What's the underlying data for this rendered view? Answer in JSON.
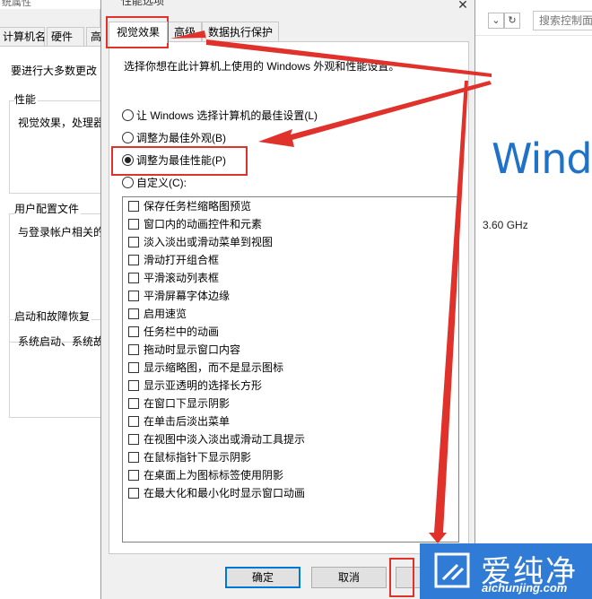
{
  "system_properties": {
    "title": "统属性",
    "tabs": [
      "计算机名",
      "硬件",
      "高"
    ],
    "intro": "要进行大多数更改",
    "groups": [
      {
        "title": "性能",
        "text": "视觉效果，处理器"
      },
      {
        "title": "用户配置文件",
        "text": "与登录帐户相关的"
      },
      {
        "title": "启动和故障恢复",
        "text": "系统启动、系统故"
      }
    ]
  },
  "system_window": {
    "search_placeholder": "搜索控制面",
    "refresh_glyph": "↻",
    "dropdown_glyph": "⌄",
    "windows_text": "Wind",
    "cpu_speed": "3.60 GHz"
  },
  "dialog": {
    "title": "性能选项",
    "close_glyph": "✕",
    "tabs": [
      "视觉效果",
      "高级",
      "数据执行保护"
    ],
    "active_tab": "视觉效果",
    "description": "选择你想在此计算机上使用的 Windows 外观和性能设置。",
    "radios": [
      {
        "label": "让 Windows 选择计算机的最佳设置(L)",
        "checked": false
      },
      {
        "label": "调整为最佳外观(B)",
        "checked": false
      },
      {
        "label": "调整为最佳性能(P)",
        "checked": true
      },
      {
        "label": "自定义(C):",
        "checked": false
      }
    ],
    "options": [
      {
        "label": "保存任务栏缩略图预览",
        "checked": false
      },
      {
        "label": "窗口内的动画控件和元素",
        "checked": false
      },
      {
        "label": "淡入淡出或滑动菜单到视图",
        "checked": false
      },
      {
        "label": "滑动打开组合框",
        "checked": false
      },
      {
        "label": "平滑滚动列表框",
        "checked": false
      },
      {
        "label": "平滑屏幕字体边缘",
        "checked": false
      },
      {
        "label": "启用速览",
        "checked": false
      },
      {
        "label": "任务栏中的动画",
        "checked": false
      },
      {
        "label": "拖动时显示窗口内容",
        "checked": false
      },
      {
        "label": "显示缩略图，而不是显示图标",
        "checked": false
      },
      {
        "label": "显示亚透明的选择长方形",
        "checked": false
      },
      {
        "label": "在窗口下显示阴影",
        "checked": false
      },
      {
        "label": "在单击后淡出菜单",
        "checked": false
      },
      {
        "label": "在视图中淡入淡出或滑动工具提示",
        "checked": false
      },
      {
        "label": "在鼠标指针下显示阴影",
        "checked": false
      },
      {
        "label": "在桌面上为图标标签使用阴影",
        "checked": false
      },
      {
        "label": "在最大化和最小化时显示窗口动画",
        "checked": false
      }
    ],
    "buttons": {
      "ok": "确定",
      "cancel": "取消"
    }
  },
  "annotation_color": "#e0312a",
  "watermark": {
    "text": "爱纯净",
    "url": "aichunjing.com",
    "color": "#2f7bd6"
  }
}
